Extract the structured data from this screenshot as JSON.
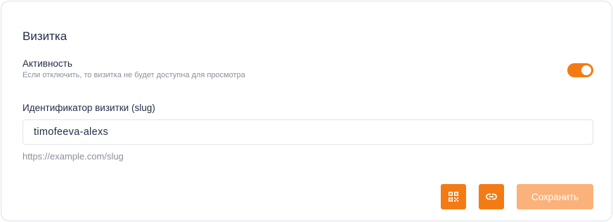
{
  "card": {
    "title": "Визитка",
    "activity": {
      "label": "Активность",
      "hint": "Если отключить, то визитка не будет доступна для просмотра",
      "enabled": true
    },
    "slug": {
      "label": "Идентификатор визитки (slug)",
      "value": "timofeeva-alexs",
      "url_hint": "https://example.com/slug"
    },
    "actions": {
      "qr_icon": "qr-code-icon",
      "link_icon": "link-icon",
      "save_label": "Сохранить"
    }
  },
  "colors": {
    "accent": "#f47a14",
    "accent_disabled": "#fab27a",
    "text_primary": "#1f2a44",
    "text_muted": "#8a8f98"
  }
}
